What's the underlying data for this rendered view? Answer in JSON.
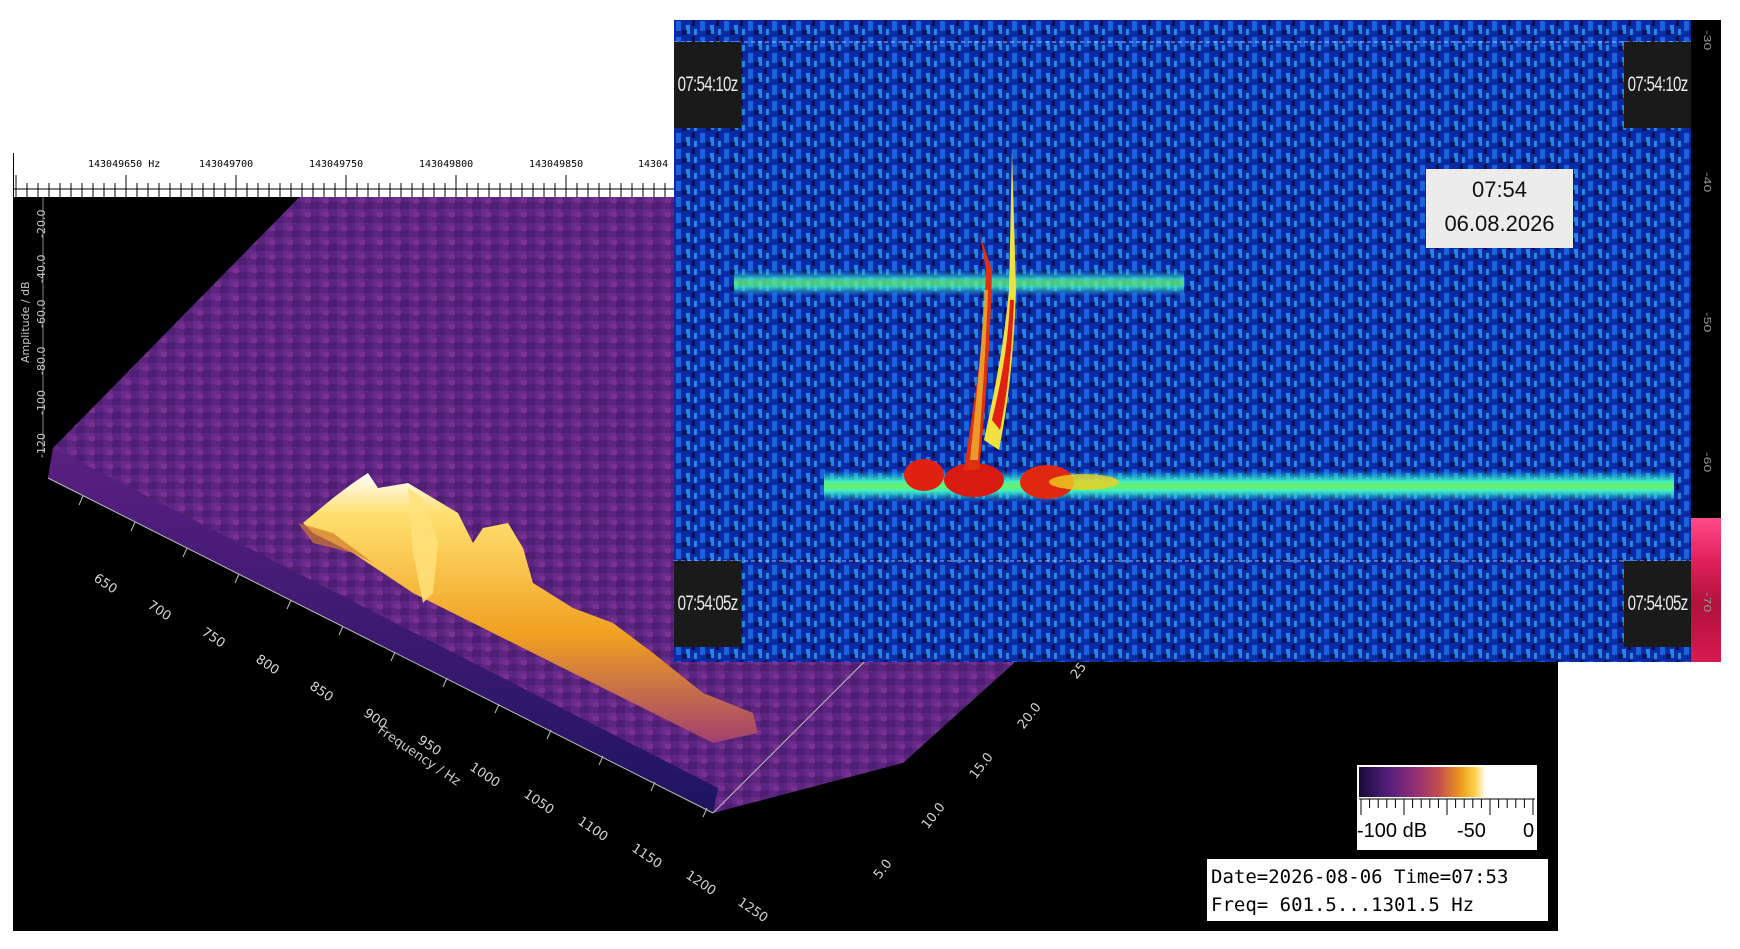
{
  "ruler": {
    "labels": [
      "143049650 Hz",
      "143049700",
      "143049750",
      "143049800",
      "143049850",
      "14304"
    ]
  },
  "plot3d": {
    "amplitude_axis_title": "Amplitude / dB",
    "amplitude_ticks": [
      "-20.0",
      "-40.0",
      "-60.0",
      "-80.0",
      "-100",
      "-120"
    ],
    "frequency_axis_title": "Frequency / Hz",
    "frequency_ticks": [
      "650",
      "700",
      "750",
      "800",
      "850",
      "900",
      "950",
      "1000",
      "1050",
      "1100",
      "1150",
      "1200",
      "1250"
    ],
    "time_ticks": [
      "5.0",
      "10.0",
      "15.0",
      "20.0",
      "25"
    ]
  },
  "color_scale": {
    "labels": [
      "-100 dB",
      "-50",
      "0"
    ]
  },
  "info": {
    "line1": "Date=2026-08-06 Time=07:53",
    "line2": "Freq= 601.5...1301.5 Hz"
  },
  "waterfall": {
    "badge_top_left": "07:54:10z",
    "badge_top_right": "07:54:10z",
    "badge_bottom_left": "07:54:05z",
    "badge_bottom_right": "07:54:05z",
    "time": "07:54",
    "date": "06.08.2026",
    "scale_labels": [
      "-30",
      "-40",
      "-50",
      "-60",
      "-70"
    ]
  },
  "colors": {
    "waterfall_bg": "#0a2aa8",
    "surface_low": "#4b1e7a",
    "surface_peak": "#ffd34a"
  }
}
